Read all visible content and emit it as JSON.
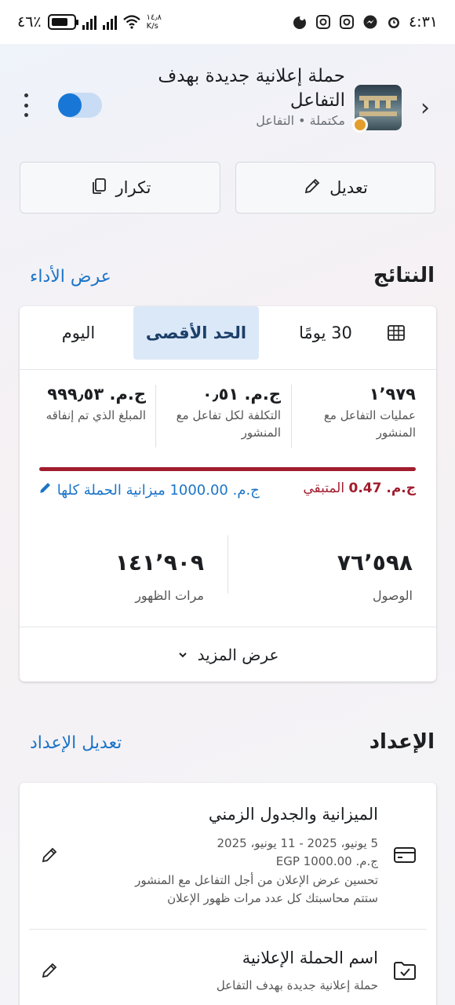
{
  "status_bar": {
    "time": "٤:٣١",
    "battery": "٤٦٪",
    "net_speed": "١٤٫٨",
    "net_unit": "K/s"
  },
  "header": {
    "campaign_title": "حملة إعلانية جديدة بهدف التفاعل",
    "campaign_status": "مكتملة • التفاعل",
    "status_color": "#e49e2b"
  },
  "actions": {
    "edit_label": "تعديل",
    "duplicate_label": "تكرار"
  },
  "results": {
    "title": "النتائج",
    "link": "عرض الأداء",
    "tabs": {
      "days30": "30 يومًا",
      "max": "الحد الأقصى",
      "today": "اليوم"
    },
    "metrics": {
      "engagements_value": "١٬٩٧٩",
      "engagements_label": "عمليات التفاعل مع المنشور",
      "cost_value": "ج.م. ٠٫٥١",
      "cost_label": "التكلفة لكل تفاعل مع المنشور",
      "spent_value": "ج.م. ٩٩٩٫٥٣",
      "spent_label": "المبلغ الذي تم إنفاقه"
    },
    "budget": {
      "remaining_amount": "ج.م. 0.47",
      "remaining_label": "المتبقي",
      "total_label": "ج.م. 1000.00 ميزانية الحملة كلها",
      "spent_fraction": 0.9995
    },
    "reach_value": "٧٦٬٥٩٨",
    "reach_label": "الوصول",
    "impressions_value": "١٤١٬٩٠٩",
    "impressions_label": "مرات الظهور",
    "see_more": "عرض المزيد"
  },
  "setup": {
    "title": "الإعداد",
    "link": "تعديل الإعداد",
    "budget_row": {
      "title": "الميزانية والجدول الزمني",
      "dates": "5 يونيو، 2025 - 11 يونيو، 2025",
      "amount": "ج.م. EGP 1000.00",
      "optimization": "تحسين عرض الإعلان من أجل التفاعل مع المنشور",
      "billing": "ستتم محاسبتك كل عدد مرات ظهور الإعلان"
    },
    "name_row": {
      "title": "اسم الحملة الإعلانية",
      "value": "حملة إعلانية جديدة بهدف التفاعل"
    }
  }
}
